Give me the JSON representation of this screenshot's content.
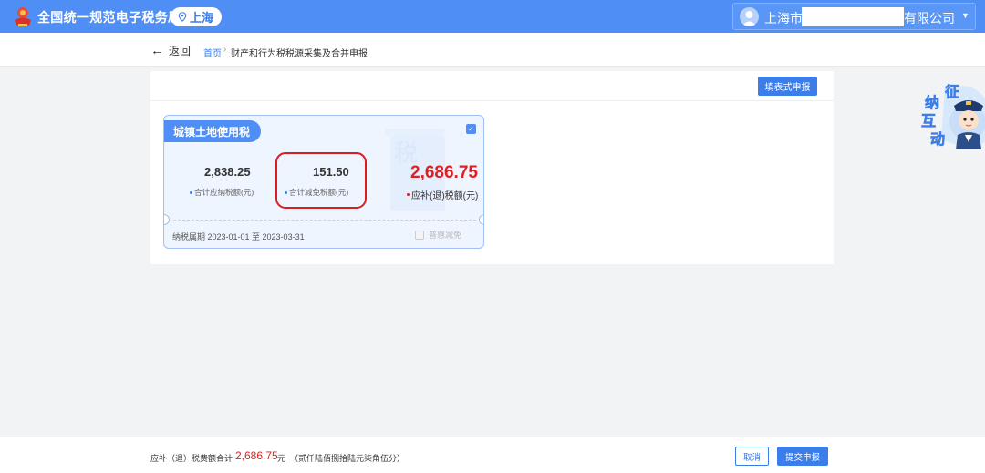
{
  "header": {
    "app_title": "全国统一规范电子税务局",
    "region": "上海",
    "user_name_prefix": "上海市",
    "user_name_suffix": "有限公司"
  },
  "breadcrumb": {
    "back_label": "返回",
    "home": "首页",
    "separator": "›",
    "current": "财产和行为税税源采集及合并申报"
  },
  "toolbar": {
    "form_declare_label": "填表式申报"
  },
  "tax_card": {
    "name": "城镇土地使用税",
    "checked": true,
    "total_payable": "2,838.25",
    "total_payable_label": "合计应纳税额(元)",
    "total_relief": "151.50",
    "total_relief_label": "合计减免税额(元)",
    "amount_due": "2,686.75",
    "amount_due_label": "应补(退)税额(元)",
    "period": "纳税属期 2023-01-01 至 2023-03-31",
    "relief_option": "普惠减免",
    "watermark_glyph": "税"
  },
  "assistant": {
    "chars": [
      "征",
      "纳",
      "互",
      "动"
    ]
  },
  "footer": {
    "total_label": "应补（退）税费额合计",
    "total_amount": "2,686.75",
    "unit": "元",
    "amount_in_words": "（贰仟陆佰捌拾陆元柒角伍分）",
    "cancel_label": "取消",
    "submit_label": "提交申报"
  },
  "colors": {
    "primary": "#4f8ef5",
    "accent_red": "#e02020",
    "highlight_border": "#d81e22"
  }
}
